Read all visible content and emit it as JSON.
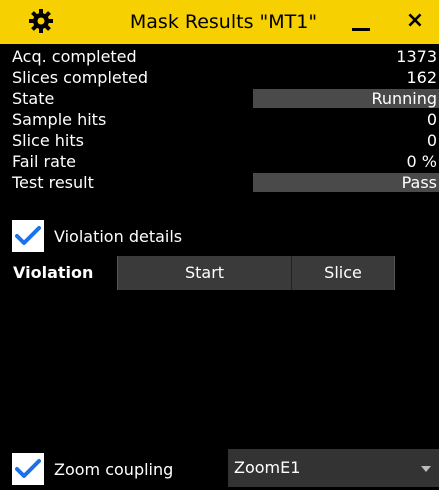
{
  "window": {
    "title": "Mask Results \"MT1\"",
    "minimize_icon": "minimize-icon",
    "close_label": "×",
    "settings_icon": "gear-icon",
    "accent_color": "#f6d000"
  },
  "results": [
    {
      "label": "Acq. completed",
      "value": "1373",
      "boxed": false
    },
    {
      "label": "Slices completed",
      "value": "162",
      "boxed": false
    },
    {
      "label": "State",
      "value": "Running",
      "boxed": true
    },
    {
      "label": "Sample hits",
      "value": "0",
      "boxed": false
    },
    {
      "label": "Slice hits",
      "value": "0",
      "boxed": false
    },
    {
      "label": "Fail rate",
      "value": "0 %",
      "boxed": false
    },
    {
      "label": "Test result",
      "value": "Pass",
      "boxed": true
    }
  ],
  "violation_details": {
    "label": "Violation details",
    "checked": true
  },
  "violation_table": {
    "columns": [
      "Violation",
      "Start",
      "Slice"
    ],
    "rows": []
  },
  "zoom_coupling": {
    "label": "Zoom coupling",
    "checked": true
  },
  "zoom_select": {
    "value": "ZoomE1"
  }
}
